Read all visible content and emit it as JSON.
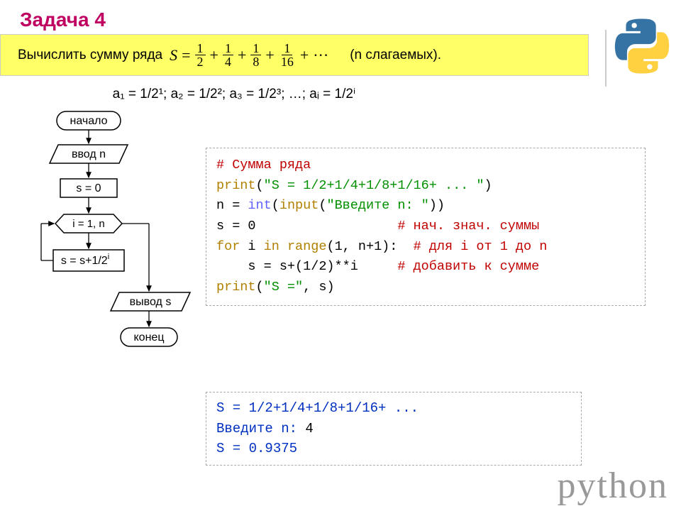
{
  "title": "Задача 4",
  "problem": {
    "prefix": "Вычислить сумму ряда",
    "S": "S",
    "fracs": [
      {
        "num": "1",
        "den": "2"
      },
      {
        "num": "1",
        "den": "4"
      },
      {
        "num": "1",
        "den": "8"
      },
      {
        "num": "1",
        "den": "16"
      }
    ],
    "dots": "···",
    "suffix": "(n слагаемых)."
  },
  "terms": "a₁ = 1/2¹;  a₂ = 1/2²;  a₃ = 1/2³;  …;  aᵢ = 1/2ⁱ",
  "flow": {
    "start": "начало",
    "input": "ввод n",
    "init_s": "s = 0",
    "loop": "i = 1, n",
    "loop_body": "s = s+1/2",
    "loop_body_sup": "i",
    "output": "вывод s",
    "end": "конец"
  },
  "code": {
    "c1": "# Сумма ряда",
    "l2a": "print",
    "l2b": "(",
    "l2s": "\"S = 1/2+1/4+1/8+1/16+ ... \"",
    "l2c": ")",
    "l3a": "n = ",
    "l3b": "int",
    "l3c": "(",
    "l3d": "input",
    "l3e": "(",
    "l3s": "\"Введите n: \"",
    "l3f": "))",
    "l4a": "s = 0                  ",
    "l4c": "# нач. знач. суммы",
    "l5a": "for",
    "l5b": " i ",
    "l5c": "in",
    "l5d": " ",
    "l5e": "range",
    "l5f": "(1, n+1):  ",
    "l5g": "# для i от 1 до n",
    "l6a": "    s = s+(1/2)**i     ",
    "l6c": "# добавить к сумме",
    "l7a": "print",
    "l7b": "(",
    "l7s": "\"S =\"",
    "l7c": ", s)"
  },
  "output": {
    "l1": "S = 1/2+1/4+1/8+1/16+ ...",
    "l2a": "Введите n: ",
    "l2b": "4",
    "l3": "S = 0.9375"
  },
  "python_word": "python"
}
